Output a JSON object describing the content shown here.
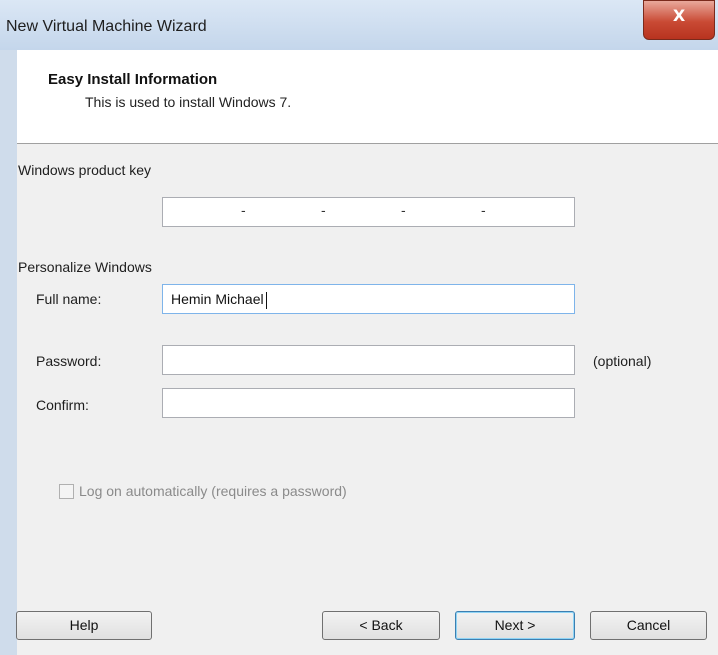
{
  "window": {
    "title": "New Virtual Machine Wizard",
    "close_glyph": "X"
  },
  "header": {
    "title": "Easy Install Information",
    "subtitle": "This is used to install Windows 7."
  },
  "product_key": {
    "label": "Windows product key",
    "separators": [
      "-",
      "-",
      "-",
      "-"
    ],
    "value": ""
  },
  "personalize": {
    "label": "Personalize Windows",
    "full_name_label": "Full name:",
    "full_name_value": "Hemin Michael",
    "password_label": "Password:",
    "password_value": "",
    "password_hint": "(optional)",
    "confirm_label": "Confirm:",
    "confirm_value": ""
  },
  "auto_logon": {
    "label": "Log on automatically (requires a password)",
    "checked": false,
    "enabled": false
  },
  "buttons": {
    "help": "Help",
    "back": "< Back",
    "next": "Next >",
    "cancel": "Cancel"
  }
}
